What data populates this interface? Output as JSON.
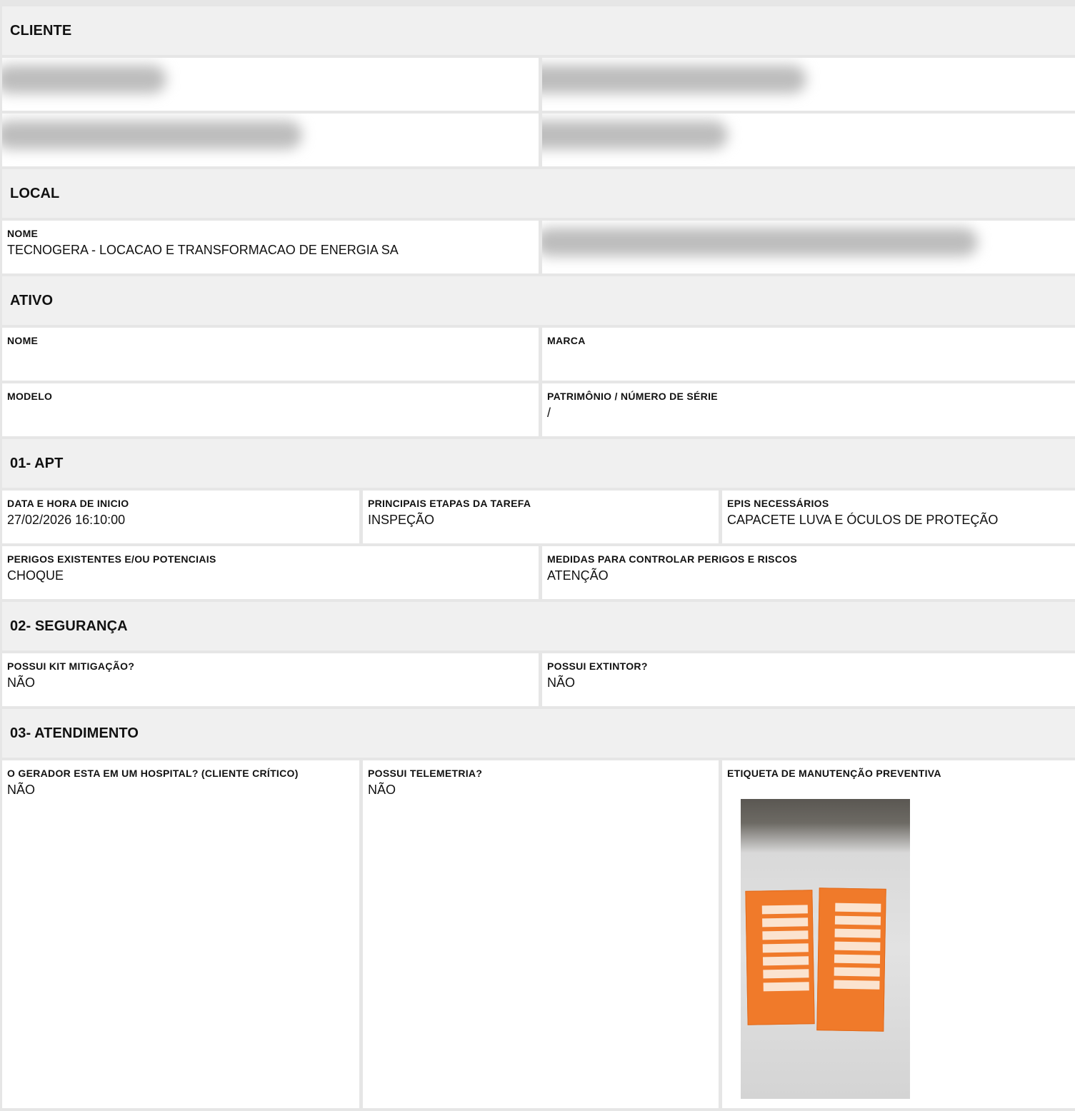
{
  "sections": {
    "cliente": {
      "title": "CLIENTE"
    },
    "local": {
      "title": "LOCAL",
      "nome": {
        "label": "NOME",
        "value": "TECNOGERA - LOCACAO E TRANSFORMACAO DE ENERGIA SA"
      }
    },
    "ativo": {
      "title": "ATIVO",
      "nome": {
        "label": "NOME",
        "value": ""
      },
      "marca": {
        "label": "MARCA",
        "value": ""
      },
      "modelo": {
        "label": "MODELO",
        "value": ""
      },
      "patrimonio": {
        "label": "PATRIMÔNIO / NÚMERO DE SÉRIE",
        "value": "/"
      }
    },
    "apt": {
      "title": "01- APT",
      "data_inicio": {
        "label": "DATA E HORA DE INICIO",
        "value": "27/02/2026 16:10:00"
      },
      "etapas": {
        "label": "PRINCIPAIS ETAPAS DA TAREFA",
        "value": "INSPEÇÃO"
      },
      "epis": {
        "label": "EPIS NECESSÁRIOS",
        "value": "CAPACETE LUVA E ÓCULOS DE PROTEÇÃO"
      },
      "perigos": {
        "label": "PERIGOS EXISTENTES E/OU POTENCIAIS",
        "value": "CHOQUE"
      },
      "medidas": {
        "label": "MEDIDAS PARA CONTROLAR PERIGOS E RISCOS",
        "value": "ATENÇÃO"
      }
    },
    "seguranca": {
      "title": "02- SEGURANÇA",
      "kit": {
        "label": "POSSUI KIT MITIGAÇÃO?",
        "value": "NÃO"
      },
      "extintor": {
        "label": "POSSUI EXTINTOR?",
        "value": "NÃO"
      }
    },
    "atendimento": {
      "title": "03- ATENDIMENTO",
      "hospital": {
        "label": "O GERADOR ESTA EM UM HOSPITAL? (CLIENTE CRÍTICO)",
        "value": "NÃO"
      },
      "telemetria": {
        "label": "POSSUI TELEMETRIA?",
        "value": "NÃO"
      },
      "etiqueta": {
        "label": "ETIQUETA DE MANUTENÇÃO PREVENTIVA"
      }
    }
  }
}
